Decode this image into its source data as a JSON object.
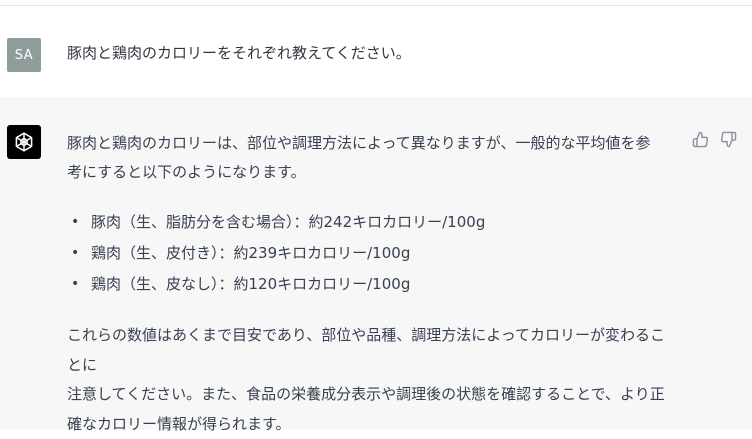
{
  "user_message": {
    "avatar_initials": "SA",
    "text": "豚肉と鶏肉のカロリーをそれぞれ教えてください。"
  },
  "assistant_message": {
    "avatar_icon": "openai-logo-icon",
    "intro_line1": "豚肉と鶏肉のカロリーは、部位や調理方法によって異なりますが、一般的な平均値を参",
    "intro_line2": "考にすると以下のようになります。",
    "items": [
      {
        "label": "豚肉（生、脂肪分を含む場合）：約242キロカロリー/100g"
      },
      {
        "label": "鶏肉（生、皮付き）：約239キロカロリー/100g"
      },
      {
        "label": "鶏肉（生、皮なし）：約120キロカロリー/100g"
      }
    ],
    "note_line1": "これらの数値はあくまで目安であり、部位や品種、調理方法によってカロリーが変わることに",
    "note_line2": "注意してください。また、食品の栄養成分表示や調理後の状態を確認することで、より正",
    "note_line3": "確なカロリー情報が得られます。",
    "actions": [
      "thumbs-up-icon",
      "thumbs-down-icon"
    ]
  },
  "colors": {
    "user_avatar_bg": "#8e9d9b",
    "bot_avatar_bg": "#000000",
    "assistant_row_bg": "#f7f7f8"
  }
}
